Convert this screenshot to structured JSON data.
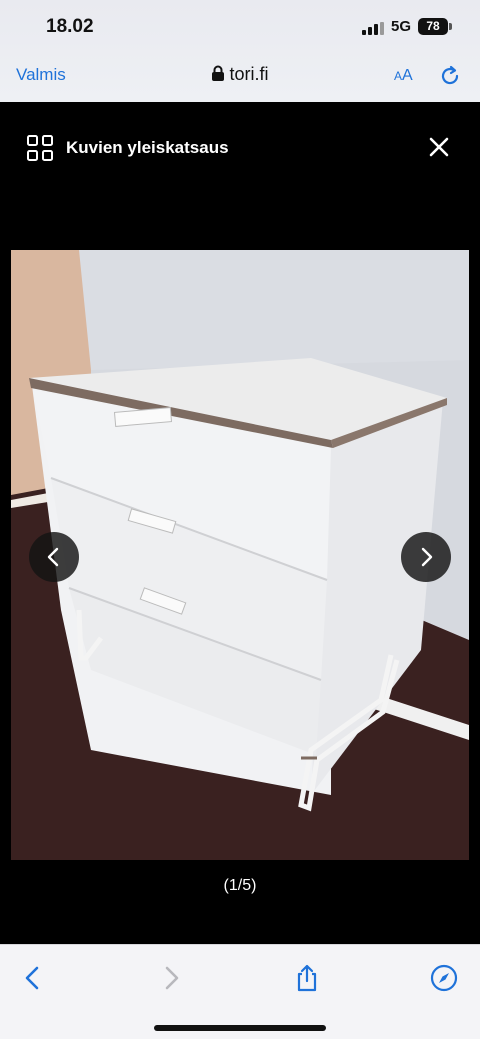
{
  "status_bar": {
    "time": "18.02",
    "network": "5G",
    "battery": "78"
  },
  "browser": {
    "done_label": "Valmis",
    "address": "tori.fi",
    "text_size_small": "A",
    "text_size_large": "A"
  },
  "viewer": {
    "title": "Kuvien yleiskatsaus",
    "counter": "(1/5)"
  },
  "colors": {
    "accent": "#1f72d9",
    "viewer_bg": "#000000"
  },
  "icons": [
    "grid-icon",
    "close-icon",
    "chevron-left-icon",
    "chevron-right-icon",
    "back-icon",
    "forward-icon",
    "share-icon",
    "compass-icon",
    "lock-icon",
    "reload-icon"
  ]
}
